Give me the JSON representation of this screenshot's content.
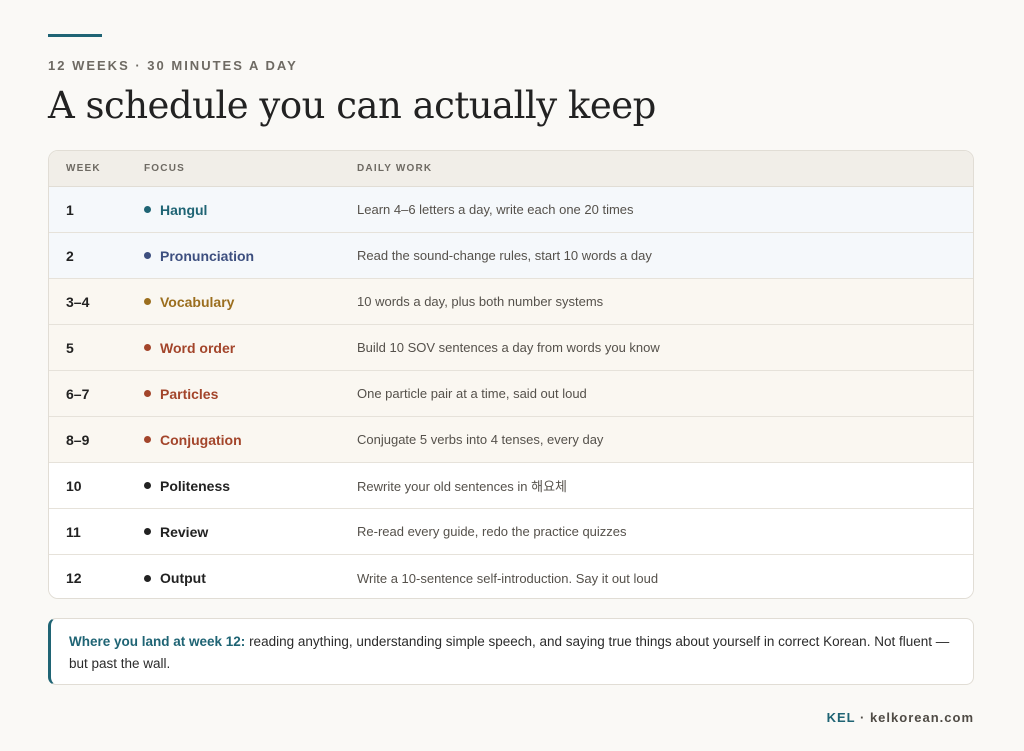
{
  "header": {
    "eyebrow": "12 WEEKS · 30 MINUTES A DAY",
    "title": "A schedule you can actually keep"
  },
  "table": {
    "columns": [
      "WEEK",
      "FOCUS",
      "DAILY WORK"
    ],
    "rows": [
      {
        "week": "1",
        "focus": "Hangul",
        "work": "Learn 4–6 letters a day, write each one 20 times",
        "color": "#1f6474",
        "bg": "#f5f8fb"
      },
      {
        "week": "2",
        "focus": "Pronunciation",
        "work": "Read the sound-change rules, start 10 words a day",
        "color": "#3d4f7f",
        "bg": "#f5f8fb"
      },
      {
        "week": "3–4",
        "focus": "Vocabulary",
        "work": "10 words a day, plus both number systems",
        "color": "#9b6e1e",
        "bg": "#faf7f1"
      },
      {
        "week": "5",
        "focus": "Word order",
        "work": "Build 10 SOV sentences a day from words you know",
        "color": "#a3452b",
        "bg": "#faf7f1"
      },
      {
        "week": "6–7",
        "focus": "Particles",
        "work": "One particle pair at a time, said out loud",
        "color": "#a3452b",
        "bg": "#faf7f1"
      },
      {
        "week": "8–9",
        "focus": "Conjugation",
        "work": "Conjugate 5 verbs into 4 tenses, every day",
        "color": "#a3452b",
        "bg": "#faf7f1"
      },
      {
        "week": "10",
        "focus": "Politeness",
        "work": "Rewrite your old sentences in 해요체",
        "color": "#222222",
        "bg": "#ffffff"
      },
      {
        "week": "11",
        "focus": "Review",
        "work": "Re-read every guide, redo the practice quizzes",
        "color": "#222222",
        "bg": "#ffffff"
      },
      {
        "week": "12",
        "focus": "Output",
        "work": "Write a 10-sentence self-introduction. Say it out loud",
        "color": "#222222",
        "bg": "#ffffff"
      }
    ]
  },
  "callout": {
    "lead": "Where you land at week 12:",
    "text": " reading anything, understanding simple speech, and saying true things about yourself in correct Korean. Not fluent — but past the wall."
  },
  "footer": {
    "brand": "KEL",
    "separator": " · ",
    "site": "kelkorean.com"
  },
  "colors": {
    "accent": "#1f6474"
  }
}
